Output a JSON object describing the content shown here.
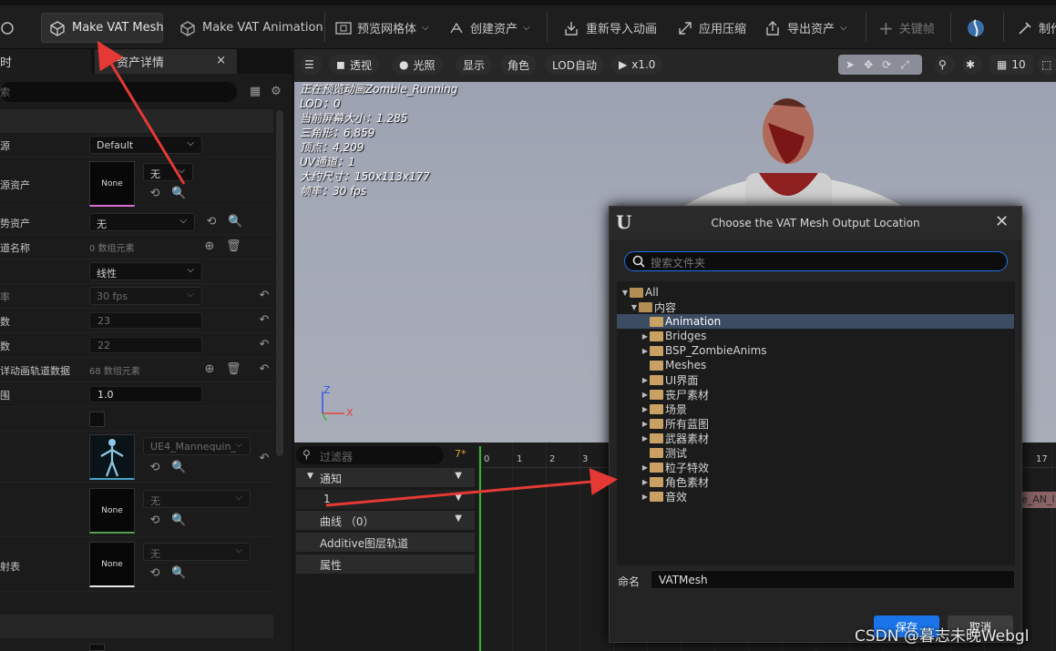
{
  "toolbar": {
    "make_vat_mesh": "Make VAT Mesh",
    "make_vat_animation": "Make VAT Animation",
    "preview_mesh": "预览网格体",
    "create_asset": "创建资产",
    "reimport_anim": "重新导入动画",
    "apply_compression": "应用压缩",
    "export_asset": "导出资产",
    "keyframe": "关键帧",
    "make": "制作"
  },
  "left_panel": {
    "tab_partial": "时",
    "tab_details": "资产详情",
    "tab_close": "×",
    "search_placeholder": "索",
    "rows": [
      {
        "label": "源",
        "value": "Default"
      },
      {
        "label": "源资产",
        "value": "无",
        "thumb": "None"
      },
      {
        "label": "势资产",
        "value": "无"
      },
      {
        "label": "道名称",
        "value": "0 数组元素"
      },
      {
        "label": "",
        "value": "线性"
      },
      {
        "label": "率",
        "value": "30 fps"
      },
      {
        "label": "数",
        "value": "23"
      },
      {
        "label": "数",
        "value": "22"
      },
      {
        "label": "详动画轨道数据",
        "value": "68 数组元素"
      },
      {
        "label": "围",
        "value": "1.0"
      },
      {
        "label": "",
        "value": ""
      },
      {
        "label": "",
        "value": "UE4_Mannequin_"
      },
      {
        "label": "",
        "value": "无",
        "thumb": "None"
      },
      {
        "label": "射表",
        "value": "无",
        "thumb": "None"
      }
    ]
  },
  "viewport": {
    "perspective": "透视",
    "lighting": "光照",
    "show": "显示",
    "character": "角色",
    "lod": "LOD自动",
    "speed": "x1.0",
    "grid_value": "10",
    "stats": [
      "正在预览动画Zombie_Running",
      "LOD：0",
      "当前屏幕大小：1.285",
      "三角形：6,859",
      "顶点：4,209",
      "UV通道：1",
      "大约尺寸：150x113x177",
      "帧率：30 fps"
    ],
    "axis_z": "Z",
    "axis_x": "X"
  },
  "timeline": {
    "filter_placeholder": "过滤器",
    "count": "7*",
    "tracks": [
      "通知",
      "1",
      "曲线 （0）",
      "Additive图层轨道",
      "属性"
    ],
    "ticks": [
      "0",
      "1",
      "2",
      "3",
      "17"
    ],
    "clip_label": "e_AN_l"
  },
  "dialog": {
    "title": "Choose the VAT Mesh Output Location",
    "search_placeholder": "搜索文件夹",
    "tree": [
      {
        "label": "All",
        "depth": 0,
        "expanded": true
      },
      {
        "label": "内容",
        "depth": 1,
        "expanded": true
      },
      {
        "label": "Animation",
        "depth": 2,
        "selected": true,
        "has_children": false
      },
      {
        "label": "Bridges",
        "depth": 2,
        "has_children": true
      },
      {
        "label": "BSP_ZombieAnims",
        "depth": 2,
        "has_children": true
      },
      {
        "label": "Meshes",
        "depth": 2,
        "has_children": false
      },
      {
        "label": "UI界面",
        "depth": 2,
        "has_children": true
      },
      {
        "label": "丧尸素材",
        "depth": 2,
        "has_children": true
      },
      {
        "label": "场景",
        "depth": 2,
        "has_children": true
      },
      {
        "label": "所有蓝图",
        "depth": 2,
        "has_children": true
      },
      {
        "label": "武器素材",
        "depth": 2,
        "has_children": true
      },
      {
        "label": "测试",
        "depth": 2,
        "has_children": false
      },
      {
        "label": "粒子特效",
        "depth": 2,
        "has_children": true
      },
      {
        "label": "角色素材",
        "depth": 2,
        "has_children": true
      },
      {
        "label": "音效",
        "depth": 2,
        "has_children": true
      }
    ],
    "name_label": "命名",
    "name_value": "VATMesh",
    "save": "保存",
    "cancel": "取消"
  },
  "watermark": "CSDN @暮志未晚Webgl",
  "colors": {
    "accent_blue": "#1a73e8",
    "selection": "#3b4c63",
    "annotation_red": "#e53935",
    "folder": "#c9a165"
  }
}
